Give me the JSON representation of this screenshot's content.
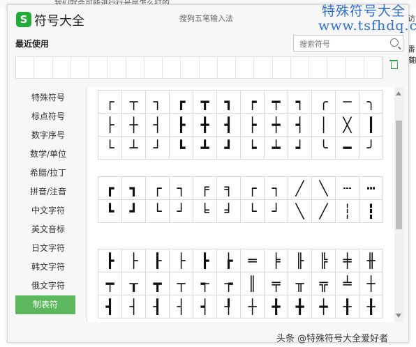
{
  "top_strip": "我们就会可能进行行号是怎么打的",
  "bg_right": [
    "访",
    "番有",
    "的"
  ],
  "window": {
    "logo": "S",
    "title": "符号大全",
    "ime_name": "搜狗五笔输入法",
    "recent_label": "最近使用",
    "search_placeholder": "搜索符号"
  },
  "watermark": {
    "line1": "特殊符号大全",
    "line2": "www.tsfhdq.cn"
  },
  "sidebar": {
    "items": [
      "特殊符号",
      "标点符号",
      "数字序号",
      "数学/单位",
      "希腊/拉丁",
      "拼音/注音",
      "中文字符",
      "英文音标",
      "日文字符",
      "韩文字符",
      "俄文字符",
      "制表符"
    ],
    "active_index": 11
  },
  "groups": [
    {
      "rows": [
        [
          "┌",
          "┬",
          "┐",
          "┏",
          "┳",
          "┓",
          "┍",
          "┯",
          "┑",
          "╭",
          "─",
          "╮"
        ],
        [
          "├",
          "┼",
          "┤",
          "┣",
          "╋",
          "┫",
          "┝",
          "┿",
          "┥",
          "│",
          "╳",
          "┃"
        ],
        [
          "└",
          "┴",
          "┘",
          "┗",
          "┻",
          "┛",
          "┕",
          "┷",
          "┙",
          "╰",
          "━",
          "╯"
        ]
      ]
    },
    {
      "rows": [
        [
          "┏",
          "┓",
          "┌",
          "┐",
          "╒",
          "╕",
          "┌",
          "┐",
          "╱",
          "╲",
          "┄",
          "┅"
        ],
        [
          "┗",
          "┛",
          "└",
          "┘",
          "╘",
          "╛",
          "└",
          "┘",
          "╲",
          "╱",
          "┆",
          "┇"
        ]
      ]
    },
    {
      "rows": [
        [
          "┣",
          "├",
          "┠",
          "├",
          "┣",
          "┢",
          "═",
          "╞",
          "╟",
          "╠",
          "╪",
          "╫"
        ],
        [
          "┯",
          "┰",
          "┳",
          "┬",
          "┭",
          "┮",
          "║",
          "╤",
          "╥",
          "╦",
          "╧",
          "┼"
        ],
        [
          "┫",
          "┤",
          "┨",
          "┤",
          "┥",
          "┦",
          "┼",
          "╋",
          "╋",
          "┿",
          "╂",
          "╂"
        ]
      ]
    }
  ],
  "footer": "头条 @特殊符号大全爱好者"
}
